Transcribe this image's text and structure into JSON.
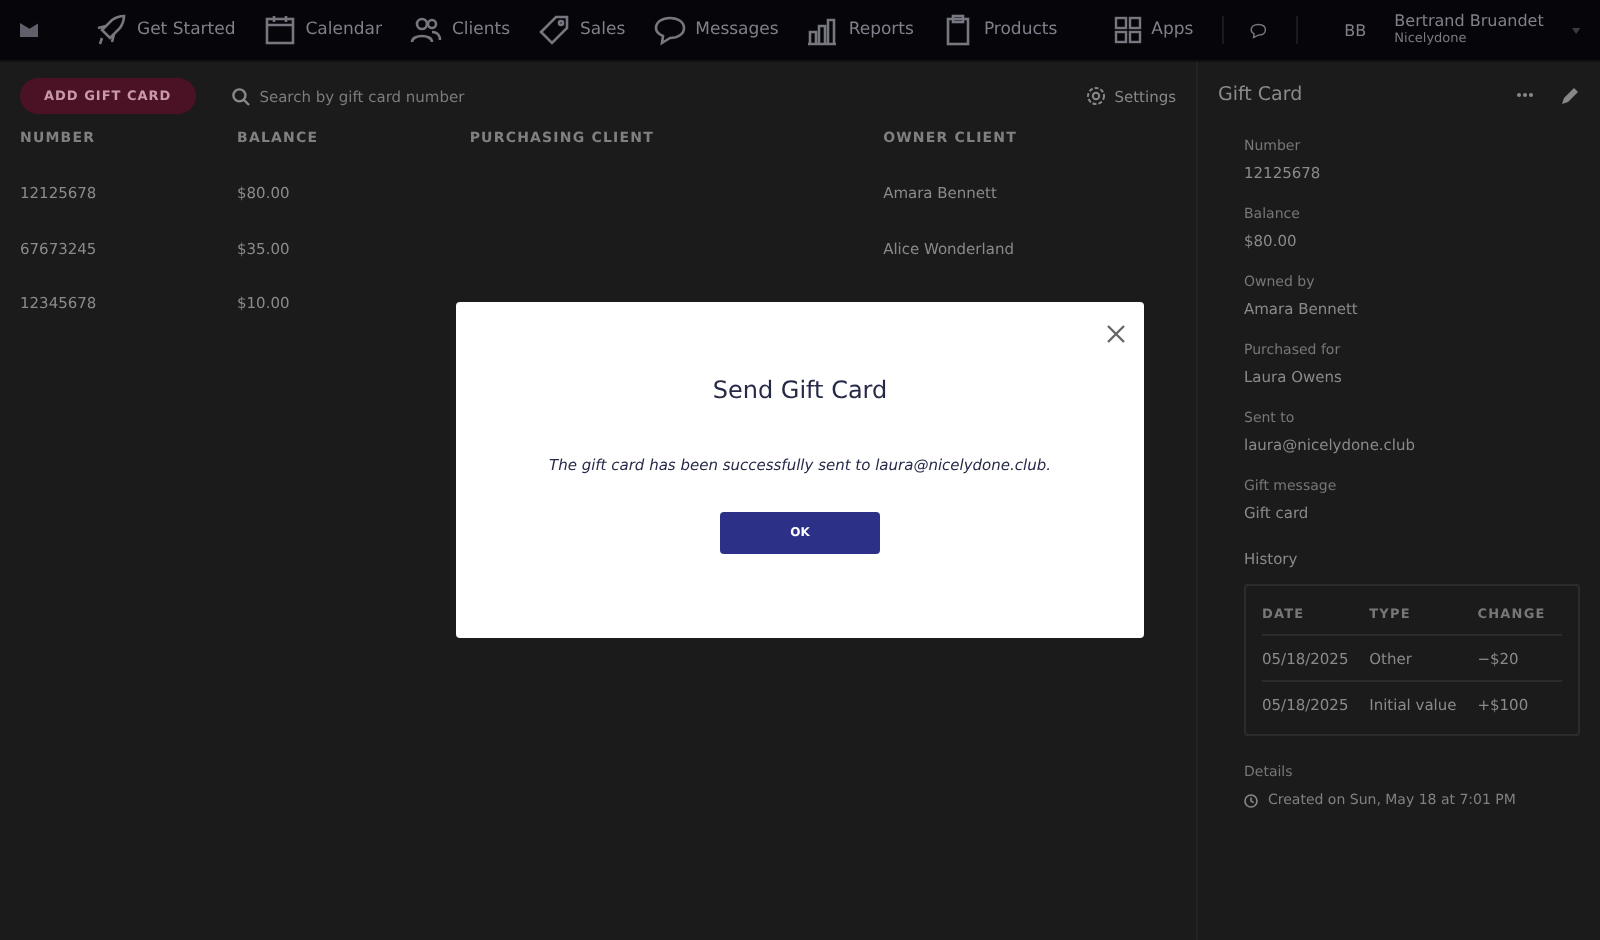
{
  "nav": {
    "items": [
      {
        "label": "Get Started"
      },
      {
        "label": "Calendar"
      },
      {
        "label": "Clients"
      },
      {
        "label": "Sales"
      },
      {
        "label": "Messages"
      },
      {
        "label": "Reports"
      },
      {
        "label": "Products"
      }
    ],
    "apps": "Apps",
    "user": {
      "initials": "BB",
      "name": "Bertrand Bruandet",
      "business": "Nicelydone"
    }
  },
  "toolbar": {
    "add_button": "ADD GIFT CARD",
    "search": {
      "placeholder": "Search by gift card number"
    },
    "settings": "Settings"
  },
  "table": {
    "columns": [
      "NUMBER",
      "BALANCE",
      "PURCHASING CLIENT",
      "OWNER CLIENT"
    ],
    "rows": [
      [
        "12125678",
        "$80.00",
        "",
        "Amara Bennett"
      ],
      [
        "67673245",
        "$35.00",
        "",
        "Alice Wonderland"
      ],
      [
        "12345678",
        "$10.00",
        "",
        ""
      ]
    ]
  },
  "panel": {
    "title": "Gift Card",
    "fields": [
      {
        "label": "Number",
        "value": "12125678"
      },
      {
        "label": "Balance",
        "value": "$80.00"
      },
      {
        "label": "Owned by",
        "value": "Amara Bennett"
      },
      {
        "label": "Purchased for",
        "value": "Laura Owens"
      },
      {
        "label": "Sent to",
        "value": "laura@nicelydone.club"
      },
      {
        "label": "Gift message",
        "value": "Gift card"
      }
    ],
    "history": {
      "title": "History",
      "columns": [
        "DATE",
        "TYPE",
        "CHANGE"
      ],
      "rows": [
        [
          "05/18/2025",
          "Other",
          "−$20"
        ],
        [
          "05/18/2025",
          "Initial value",
          "+$100"
        ]
      ]
    },
    "details": {
      "title": "Details",
      "created": "Created on Sun, May 18 at 7:01 PM"
    }
  },
  "modal": {
    "title": "Send Gift Card",
    "message": "The gift card has been successfully sent to laura@nicelydone.club.",
    "button": "OK"
  }
}
